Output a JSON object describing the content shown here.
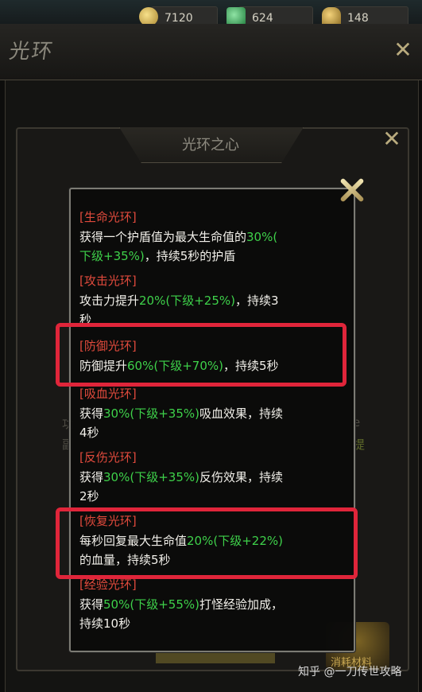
{
  "resources": {
    "gold": "7120",
    "jade": "624",
    "ingot": "148"
  },
  "window": {
    "title": "光环"
  },
  "sub_window": {
    "title": "光环之心",
    "faint_left_top": "功",
    "faint_left_bottom": "副",
    "faint_right_top": "e",
    "faint_right_bottom": "提",
    "consume_label": "消耗材料"
  },
  "auras": [
    {
      "name": "[生命光环]",
      "line1": [
        "获得一个护盾值为最大生命值的",
        "30%(",
        ""
      ],
      "line2": [
        "",
        "下级+35%)",
        "，持续5秒的护盾"
      ]
    },
    {
      "name": "[攻击光环]",
      "line1": [
        "攻击力提升",
        "20%(下级+25%)",
        "，持续3"
      ],
      "line2": [
        "秒",
        "",
        ""
      ]
    },
    {
      "name": "[防御光环]",
      "line1": [
        "防御提升",
        "60%(下级+70%)",
        "，持续5秒"
      ],
      "line2": [
        "",
        "",
        ""
      ]
    },
    {
      "name": "[吸血光环]",
      "line1": [
        "获得",
        "30%(下级+35%)",
        "吸血效果，持续"
      ],
      "line2": [
        "4秒",
        "",
        ""
      ]
    },
    {
      "name": "[反伤光环]",
      "line1": [
        "获得",
        "30%(下级+35%)",
        "反伤效果，持续"
      ],
      "line2": [
        "2秒",
        "",
        ""
      ]
    },
    {
      "name": "[恢复光环]",
      "line1": [
        "每秒回复最大生命值",
        "20%(下级+22%)",
        ""
      ],
      "line2": [
        "的血量，持续5秒",
        "",
        ""
      ]
    },
    {
      "name": "[经验光环]",
      "line1": [
        "获得",
        "50%(下级+55%)",
        "打怪经验加成，"
      ],
      "line2": [
        "持续10秒",
        "",
        ""
      ]
    }
  ],
  "colors": {
    "aura_title": "#e04a3c",
    "value_green": "#3ed14a",
    "highlight_red": "#e0253a"
  },
  "watermark": "知乎 @一刀传世攻略"
}
